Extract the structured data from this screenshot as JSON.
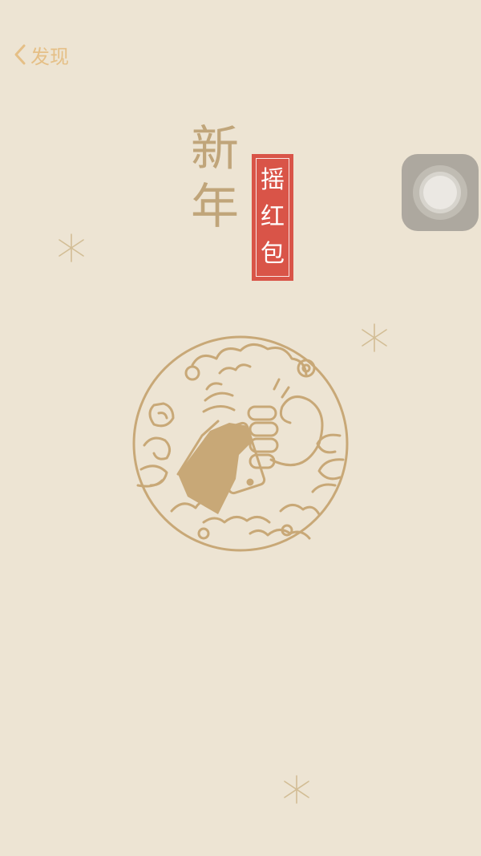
{
  "nav": {
    "back_label": "发现"
  },
  "title": {
    "big_chars": [
      "新",
      "年"
    ],
    "seal_chars": [
      "摇",
      "红",
      "包"
    ]
  },
  "colors": {
    "background": "#ede4d3",
    "gold": "#c0a57a",
    "back_link": "#e5bf86",
    "seal_red": "#d95448"
  },
  "icons": {
    "back": "chevron-left-icon",
    "assistive": "assistive-touch-icon",
    "emblem": "shake-phone-emblem-icon",
    "sparkle": "sparkle-icon"
  }
}
